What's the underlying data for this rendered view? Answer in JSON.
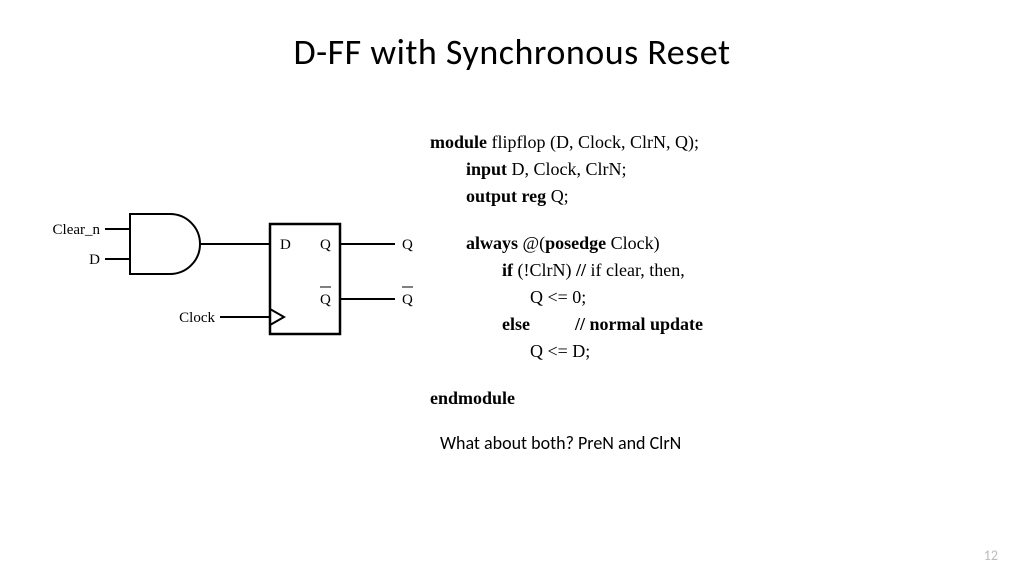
{
  "title": "D-FF with Synchronous Reset",
  "diagram": {
    "input_top": "Clear_n",
    "input_bottom": "D",
    "clock_label": "Clock",
    "ff_d": "D",
    "ff_q": "Q",
    "ff_qbar": "Q",
    "out_q": "Q",
    "out_qbar": "Q"
  },
  "code": {
    "l1a": "module",
    "l1b": " flipflop (D, Clock, ClrN, Q);",
    "l2a": "input",
    "l2b": " D, Clock, ClrN;",
    "l3a": "output reg",
    "l3b": " Q;",
    "l4a": "always",
    "l4b": " @(",
    "l4c": "posedge",
    "l4d": " Clock)",
    "l5a": "if",
    "l5b": " (!ClrN) ",
    "l5c": "//",
    "l5d": " if clear, then,",
    "l6": "Q <= 0;",
    "l7a": "else          // normal update",
    "l8": "Q <= D;",
    "l9": "endmodule"
  },
  "question": "What about both? PreN and ClrN",
  "page": "12"
}
